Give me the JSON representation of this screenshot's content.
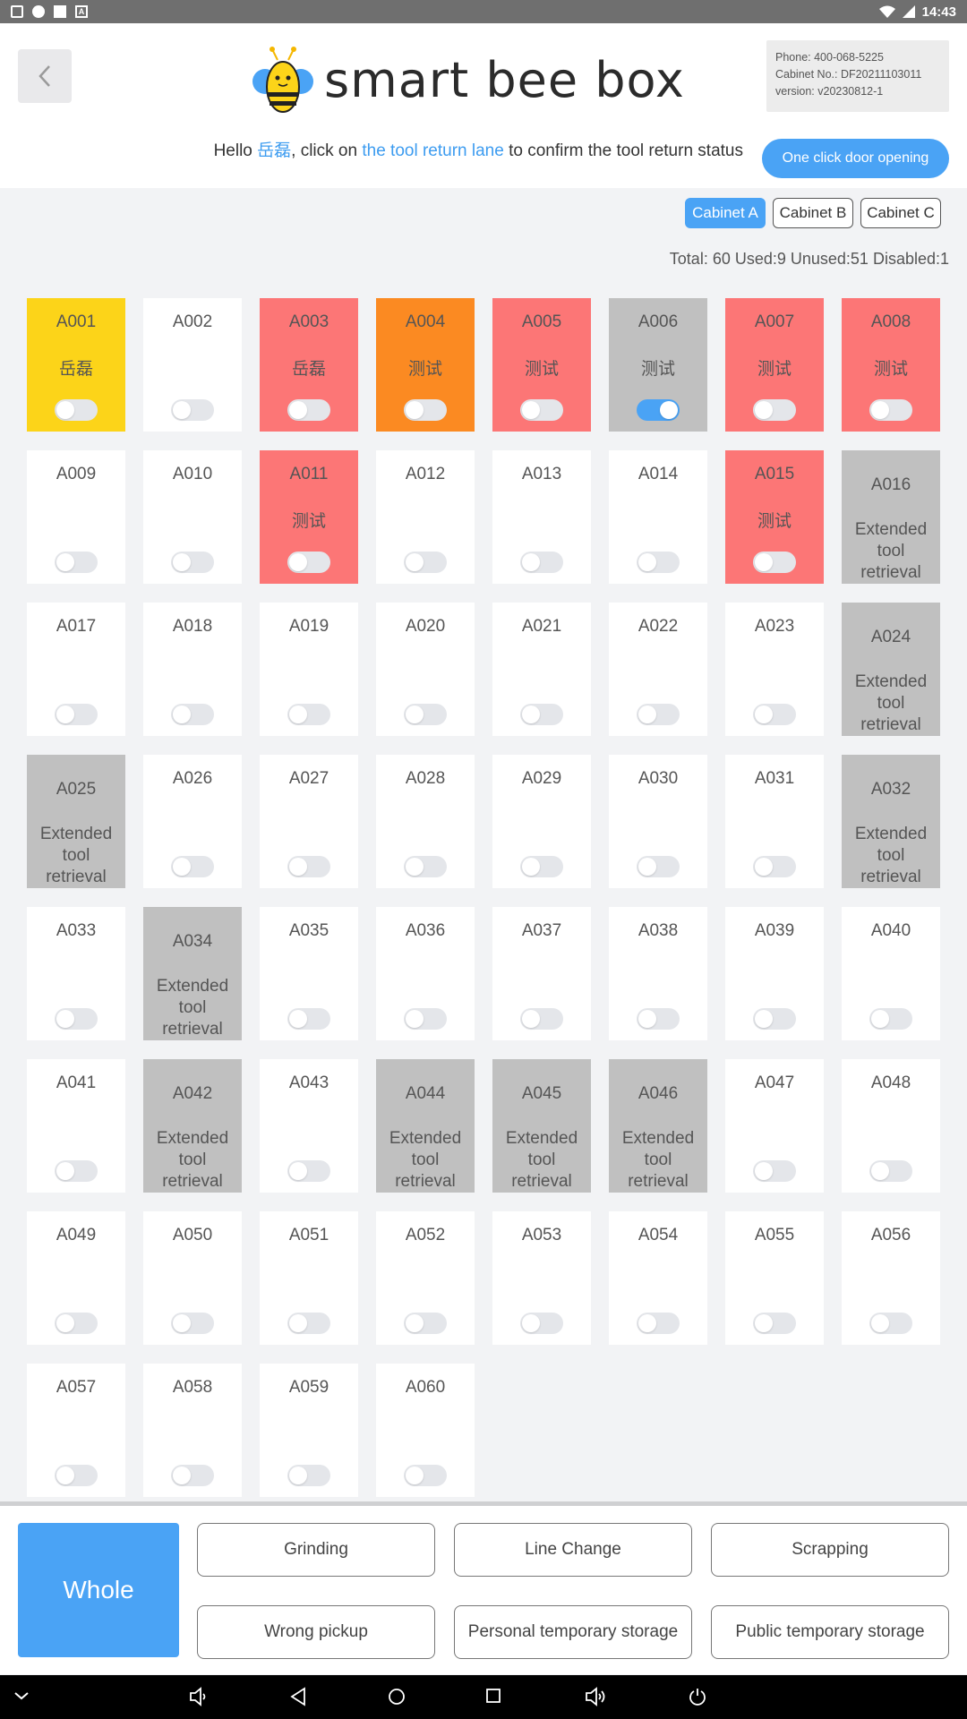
{
  "status_bar": {
    "time": "14:43"
  },
  "header": {
    "logo_text": "smart bee box",
    "info": {
      "phone": "Phone: 400-068-5225",
      "cabinet_no": "Cabinet No.: DF20211103011",
      "version": "version: v20230812-1"
    },
    "greeting": {
      "hello": "Hello ",
      "user": "岳磊",
      "mid": ", click on ",
      "link": "the tool return lane",
      "end": " to confirm the tool return status"
    },
    "door_button": "One click door opening"
  },
  "tabs": [
    "Cabinet A",
    "Cabinet B",
    "Cabinet C"
  ],
  "active_tab": "Cabinet A",
  "stats": "Total: 60 Used:9 Unused:51 Disabled:1",
  "colors": {
    "blue": "#4aa3f5",
    "yellow": "#fcd419",
    "red": "#fc7676",
    "orange": "#fb8a22",
    "gray": "#c0c0c0"
  },
  "cells": [
    {
      "code": "A001",
      "user": "岳磊",
      "status": "yellow",
      "toggle": false
    },
    {
      "code": "A002",
      "user": "",
      "status": "free",
      "toggle": false
    },
    {
      "code": "A003",
      "user": "岳磊",
      "status": "red",
      "toggle": false
    },
    {
      "code": "A004",
      "user": "测试",
      "status": "orange",
      "toggle": false
    },
    {
      "code": "A005",
      "user": "测试",
      "status": "red",
      "toggle": false
    },
    {
      "code": "A006",
      "user": "测试",
      "status": "gray",
      "toggle": true
    },
    {
      "code": "A007",
      "user": "测试",
      "status": "red",
      "toggle": false
    },
    {
      "code": "A008",
      "user": "测试",
      "status": "red",
      "toggle": false
    },
    {
      "code": "A009",
      "user": "",
      "status": "free",
      "toggle": false
    },
    {
      "code": "A010",
      "user": "",
      "status": "free",
      "toggle": false
    },
    {
      "code": "A011",
      "user": "测试",
      "status": "red",
      "toggle": false
    },
    {
      "code": "A012",
      "user": "",
      "status": "free",
      "toggle": false
    },
    {
      "code": "A013",
      "user": "",
      "status": "free",
      "toggle": false
    },
    {
      "code": "A014",
      "user": "",
      "status": "free",
      "toggle": false
    },
    {
      "code": "A015",
      "user": "测试",
      "status": "red",
      "toggle": false
    },
    {
      "code": "A016",
      "ext": "Extended tool retrieval",
      "status": "gray"
    },
    {
      "code": "A017",
      "user": "",
      "status": "free",
      "toggle": false
    },
    {
      "code": "A018",
      "user": "",
      "status": "free",
      "toggle": false
    },
    {
      "code": "A019",
      "user": "",
      "status": "free",
      "toggle": false
    },
    {
      "code": "A020",
      "user": "",
      "status": "free",
      "toggle": false
    },
    {
      "code": "A021",
      "user": "",
      "status": "free",
      "toggle": false
    },
    {
      "code": "A022",
      "user": "",
      "status": "free",
      "toggle": false
    },
    {
      "code": "A023",
      "user": "",
      "status": "free",
      "toggle": false
    },
    {
      "code": "A024",
      "ext": "Extended tool retrieval",
      "status": "gray"
    },
    {
      "code": "A025",
      "ext": "Extended tool retrieval",
      "status": "gray"
    },
    {
      "code": "A026",
      "user": "",
      "status": "free",
      "toggle": false
    },
    {
      "code": "A027",
      "user": "",
      "status": "free",
      "toggle": false
    },
    {
      "code": "A028",
      "user": "",
      "status": "free",
      "toggle": false
    },
    {
      "code": "A029",
      "user": "",
      "status": "free",
      "toggle": false
    },
    {
      "code": "A030",
      "user": "",
      "status": "free",
      "toggle": false
    },
    {
      "code": "A031",
      "user": "",
      "status": "free",
      "toggle": false
    },
    {
      "code": "A032",
      "ext": "Extended tool retrieval",
      "status": "gray"
    },
    {
      "code": "A033",
      "user": "",
      "status": "free",
      "toggle": false
    },
    {
      "code": "A034",
      "ext": "Extended tool retrieval",
      "status": "gray"
    },
    {
      "code": "A035",
      "user": "",
      "status": "free",
      "toggle": false
    },
    {
      "code": "A036",
      "user": "",
      "status": "free",
      "toggle": false
    },
    {
      "code": "A037",
      "user": "",
      "status": "free",
      "toggle": false
    },
    {
      "code": "A038",
      "user": "",
      "status": "free",
      "toggle": false
    },
    {
      "code": "A039",
      "user": "",
      "status": "free",
      "toggle": false
    },
    {
      "code": "A040",
      "user": "",
      "status": "free",
      "toggle": false
    },
    {
      "code": "A041",
      "user": "",
      "status": "free",
      "toggle": false
    },
    {
      "code": "A042",
      "ext": "Extended tool retrieval",
      "status": "gray"
    },
    {
      "code": "A043",
      "user": "",
      "status": "free",
      "toggle": false
    },
    {
      "code": "A044",
      "ext": "Extended tool retrieval",
      "status": "gray"
    },
    {
      "code": "A045",
      "ext": "Extended tool retrieval",
      "status": "gray"
    },
    {
      "code": "A046",
      "ext": "Extended tool retrieval",
      "status": "gray"
    },
    {
      "code": "A047",
      "user": "",
      "status": "free",
      "toggle": false
    },
    {
      "code": "A048",
      "user": "",
      "status": "free",
      "toggle": false
    },
    {
      "code": "A049",
      "user": "",
      "status": "free",
      "toggle": false
    },
    {
      "code": "A050",
      "user": "",
      "status": "free",
      "toggle": false
    },
    {
      "code": "A051",
      "user": "",
      "status": "free",
      "toggle": false
    },
    {
      "code": "A052",
      "user": "",
      "status": "free",
      "toggle": false
    },
    {
      "code": "A053",
      "user": "",
      "status": "free",
      "toggle": false
    },
    {
      "code": "A054",
      "user": "",
      "status": "free",
      "toggle": false
    },
    {
      "code": "A055",
      "user": "",
      "status": "free",
      "toggle": false
    },
    {
      "code": "A056",
      "user": "",
      "status": "free",
      "toggle": false
    },
    {
      "code": "A057",
      "user": "",
      "status": "free",
      "toggle": false
    },
    {
      "code": "A058",
      "user": "",
      "status": "free",
      "toggle": false
    },
    {
      "code": "A059",
      "user": "",
      "status": "free",
      "toggle": false
    },
    {
      "code": "A060",
      "user": "",
      "status": "free",
      "toggle": false
    }
  ],
  "bottom": {
    "whole": "Whole",
    "buttons": [
      "Grinding",
      "Line Change",
      "Scrapping",
      "Wrong pickup",
      "Personal temporary storage",
      "Public temporary storage"
    ]
  },
  "nav_icons": [
    "chevron-down-icon",
    "volume-down-icon",
    "nav-back-icon",
    "nav-home-icon",
    "nav-recents-icon",
    "volume-up-icon",
    "power-icon"
  ]
}
